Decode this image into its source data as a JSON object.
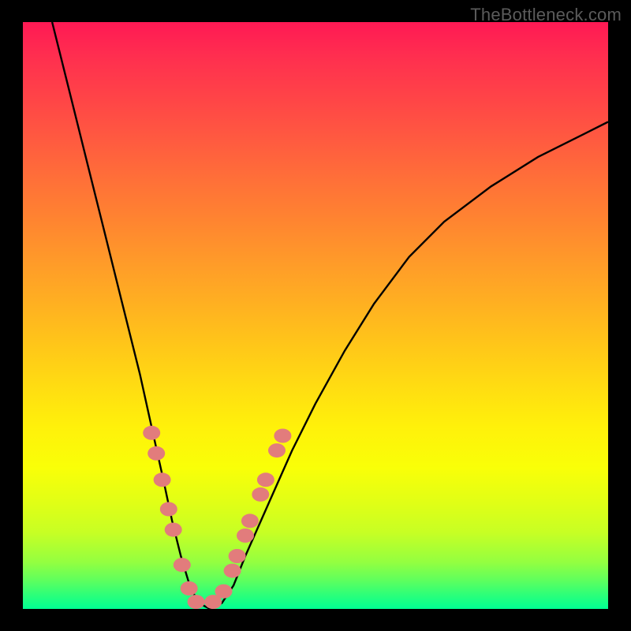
{
  "watermark": "TheBottleneck.com",
  "colors": {
    "frame": "#000000",
    "curve_stroke": "#000000",
    "marker_fill": "#e27c7c",
    "gradient_top": "#ff1954",
    "gradient_bottom": "#00ff93"
  },
  "chart_data": {
    "type": "line",
    "title": "",
    "xlabel": "",
    "ylabel": "",
    "xlim": [
      0,
      100
    ],
    "ylim": [
      0,
      100
    ],
    "grid": false,
    "series": [
      {
        "name": "bottleneck-curve",
        "x": [
          5,
          8,
          11,
          14,
          17,
          20,
          22,
          24,
          25.5,
          27,
          28.5,
          30,
          32,
          34,
          36,
          38,
          42,
          46,
          50,
          55,
          60,
          66,
          72,
          80,
          88,
          96,
          100
        ],
        "y": [
          100,
          88,
          76,
          64,
          52,
          40,
          31,
          22,
          15,
          9,
          4,
          1,
          0,
          1,
          4,
          9,
          18,
          27,
          35,
          44,
          52,
          60,
          66,
          72,
          77,
          81,
          83
        ]
      }
    ],
    "markers": {
      "name": "threshold-points",
      "points": [
        {
          "x": 22.0,
          "y": 30
        },
        {
          "x": 22.8,
          "y": 26.5
        },
        {
          "x": 23.8,
          "y": 22
        },
        {
          "x": 24.9,
          "y": 17
        },
        {
          "x": 25.7,
          "y": 13.5
        },
        {
          "x": 27.2,
          "y": 7.5
        },
        {
          "x": 28.4,
          "y": 3.5
        },
        {
          "x": 29.6,
          "y": 1.2
        },
        {
          "x": 32.5,
          "y": 1.2
        },
        {
          "x": 34.3,
          "y": 3
        },
        {
          "x": 35.8,
          "y": 6.5
        },
        {
          "x": 36.6,
          "y": 9
        },
        {
          "x": 38.0,
          "y": 12.5
        },
        {
          "x": 38.8,
          "y": 15
        },
        {
          "x": 40.6,
          "y": 19.5
        },
        {
          "x": 41.5,
          "y": 22
        },
        {
          "x": 43.4,
          "y": 27
        },
        {
          "x": 44.4,
          "y": 29.5
        }
      ]
    }
  }
}
